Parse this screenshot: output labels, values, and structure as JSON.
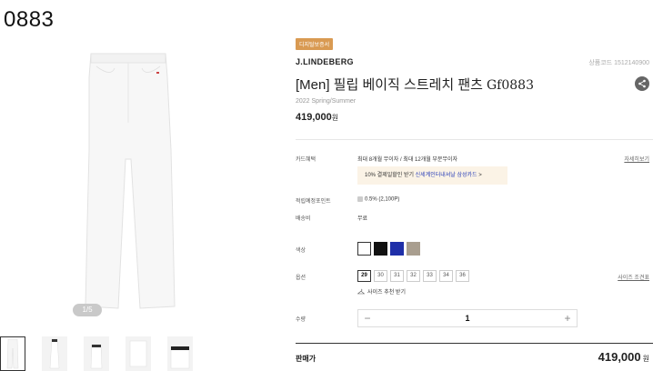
{
  "page_title": "0883",
  "gallery": {
    "pager": "1/5",
    "thumb_count": 5
  },
  "product": {
    "badge": "디지털보증서",
    "brand": "J.LINDEBERG",
    "code": "상품코드 1512140900",
    "name_ko": "[Men] 필립 베이직 스트레치 팬츠",
    "name_en": "Gf0883",
    "season": "2022 Spring/Summer",
    "price": "419,000",
    "price_unit": "원"
  },
  "details": {
    "card_label": "카드혜택",
    "card_value": "최대 8개월 무이자 / 최대 12개월 부분무이자",
    "card_link": "자세히보기",
    "promo_prefix": "10% 결제일할인 받기",
    "promo_highlight": "신세계인터내셔날 삼성카드",
    "promo_arrow": ">",
    "points_label": "적립예정포인트",
    "points_value": "0.5% (2,100P)",
    "shipping_label": "배송비",
    "shipping_value": "무료",
    "color_label": "색상",
    "option_label": "옵션",
    "size_guide": "사이즈 조견표",
    "size_rec": "사이즈 추천 받기",
    "qty_label": "수량",
    "qty_minus": "−",
    "qty_value": "1",
    "qty_plus": "+"
  },
  "colors": [
    "#ffffff",
    "#111111",
    "#1f2fa8",
    "#a99e8f"
  ],
  "selected_color": 0,
  "sizes": [
    "29",
    "30",
    "31",
    "32",
    "33",
    "34",
    "36"
  ],
  "selected_size": 0,
  "footer": {
    "sale_label": "판매가",
    "sale_price": "419,000",
    "sale_unit": "원"
  }
}
